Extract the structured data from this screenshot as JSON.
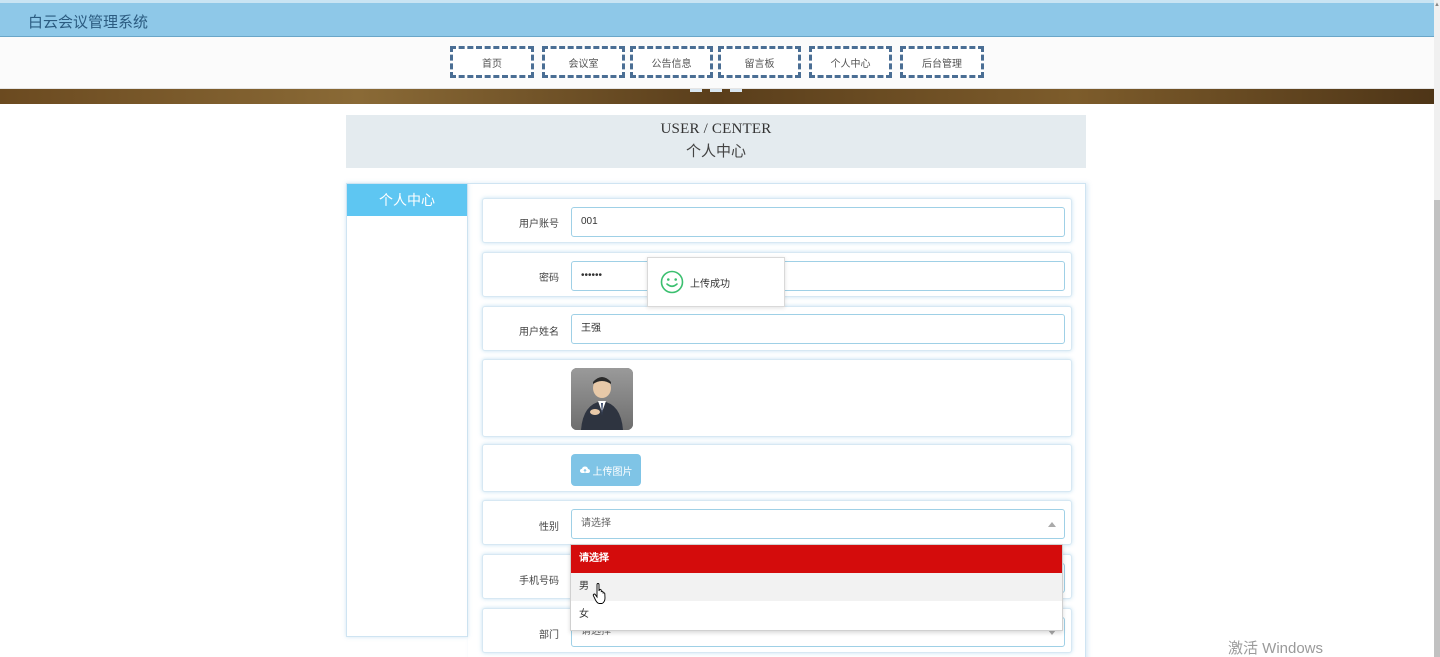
{
  "app": {
    "title": "白云会议管理系统"
  },
  "nav": [
    {
      "label": "首页"
    },
    {
      "label": "会议室"
    },
    {
      "label": "公告信息"
    },
    {
      "label": "留言板"
    },
    {
      "label": "个人中心"
    },
    {
      "label": "后台管理"
    }
  ],
  "section": {
    "title_en": "USER / CENTER",
    "title_cn": "个人中心"
  },
  "sidebar": {
    "active_label": "个人中心"
  },
  "form": {
    "account": {
      "label": "用户账号",
      "value": "001"
    },
    "password": {
      "label": "密码",
      "value": "••••••"
    },
    "name": {
      "label": "用户姓名",
      "value": "王强"
    },
    "upload": {
      "button_label": "上传图片"
    },
    "gender": {
      "label": "性别",
      "placeholder": "请选择",
      "options": [
        "请选择",
        "男",
        "女"
      ],
      "selected": "请选择"
    },
    "phone": {
      "label": "手机号码"
    },
    "department": {
      "label": "部门",
      "placeholder": "请选择"
    }
  },
  "toast": {
    "message": "上传成功"
  },
  "watermark": "激活 Windows",
  "colors": {
    "header_bg": "#8ec8e8",
    "sidebar_active": "#5ec6f2",
    "option_selected": "#d40c0c",
    "upload_button": "#7fc4e6"
  }
}
